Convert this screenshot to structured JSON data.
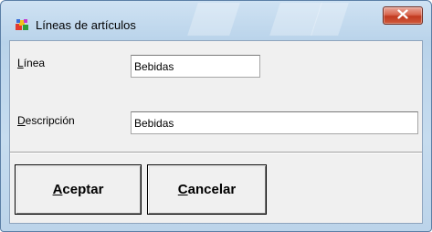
{
  "window": {
    "title": "Líneas de artículos",
    "app_icon": "colorful-blocks-icon",
    "close_icon": "close-icon"
  },
  "form": {
    "linea": {
      "label_mnemonic": "L",
      "label_rest": "ínea",
      "value": "Bebidas"
    },
    "descripcion": {
      "label_mnemonic": "D",
      "label_rest": "escripción",
      "value": "Bebidas"
    }
  },
  "buttons": {
    "accept": {
      "mnemonic": "A",
      "rest": "ceptar"
    },
    "cancel": {
      "mnemonic": "C",
      "rest": "ancelar"
    }
  },
  "colors": {
    "client_bg": "#f0f0f0",
    "frame_blue": "#b9d3ea",
    "close_red": "#c13a20"
  }
}
